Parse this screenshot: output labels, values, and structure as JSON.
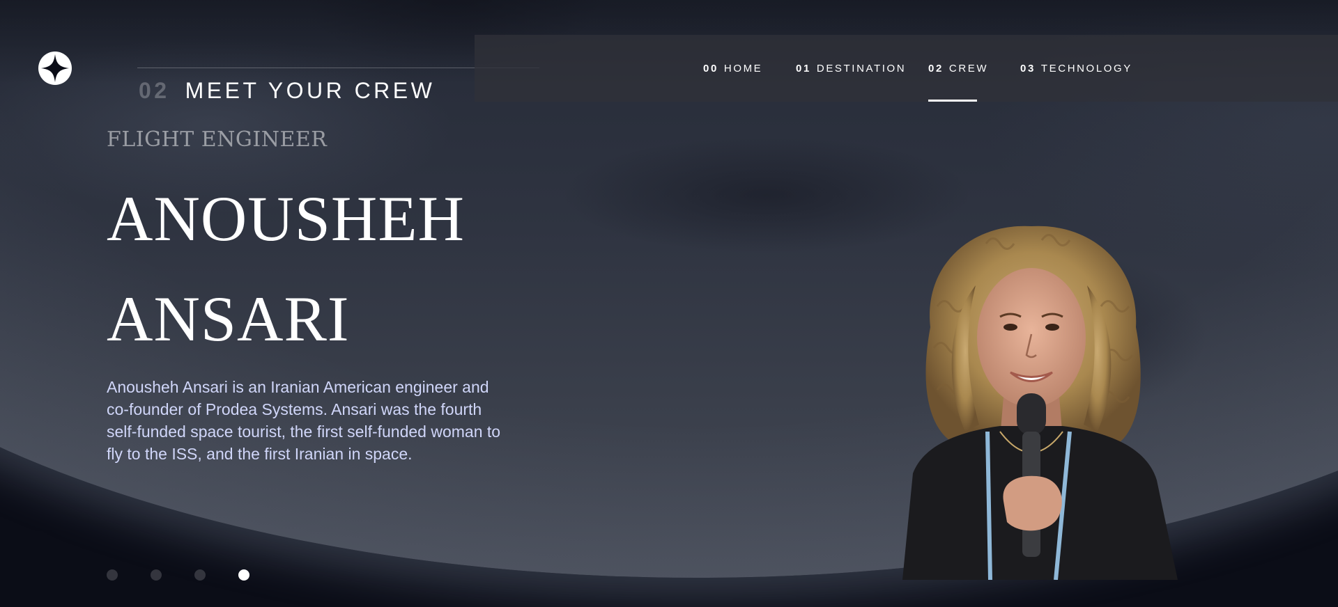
{
  "header": {
    "logo_icon": "star-logo-icon"
  },
  "nav": {
    "items": [
      {
        "num": "00",
        "label": "HOME",
        "active": false
      },
      {
        "num": "01",
        "label": "DESTINATION",
        "active": false
      },
      {
        "num": "02",
        "label": "CREW",
        "active": true
      },
      {
        "num": "03",
        "label": "TECHNOLOGY",
        "active": false
      }
    ]
  },
  "page": {
    "heading_num": "02",
    "heading_text": "MEET YOUR CREW"
  },
  "crew": {
    "role": "Flight Engineer",
    "name": "Anousheh Ansari",
    "bio": "Anousheh Ansari is an Iranian American engineer and co-founder of Prodea Systems. Ansari was the fourth self-funded space tourist, the first self-funded woman to fly to the ISS, and the first Iranian in space."
  },
  "pagination": {
    "total": 4,
    "active_index": 3
  },
  "colors": {
    "background": "#0b0d17",
    "accent_text": "#d0d6f9",
    "white": "#ffffff"
  }
}
